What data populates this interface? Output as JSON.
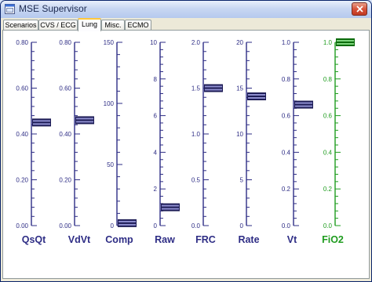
{
  "window": {
    "title": "MSE Supervisor"
  },
  "tabs": [
    {
      "label": "Scenarios",
      "active": false
    },
    {
      "label": "CVS / ECG",
      "active": false
    },
    {
      "label": "Lung",
      "active": true
    },
    {
      "label": "Misc.",
      "active": false
    },
    {
      "label": "ECMO",
      "active": false
    }
  ],
  "colors": {
    "gauge": "#2e2d85",
    "gauge_active": "#1f9c1f",
    "thumb_dark": "#1c1b55",
    "thumb_light": "#8f8fd0",
    "thumb_green_dark": "#0b6b0b",
    "thumb_green_light": "#7cd47c"
  },
  "icons": {
    "window": "app-window-icon",
    "close": "close-icon"
  },
  "gauges": [
    {
      "id": "qsqt",
      "label": "QsQt",
      "ticks": [
        "0.80",
        "0.60",
        "0.40",
        "0.20",
        "0.00"
      ],
      "min": 0,
      "max": 0.8,
      "value": 0.45,
      "color": "default"
    },
    {
      "id": "vdvt",
      "label": "VdVt",
      "ticks": [
        "0.80",
        "0.60",
        "0.40",
        "0.20",
        "0.00"
      ],
      "min": 0,
      "max": 0.8,
      "value": 0.46,
      "color": "default"
    },
    {
      "id": "comp",
      "label": "Comp",
      "ticks": [
        "150",
        "100",
        "50",
        "0"
      ],
      "min": 0,
      "max": 150,
      "value": 2,
      "color": "default"
    },
    {
      "id": "raw",
      "label": "Raw",
      "ticks": [
        "10",
        "8",
        "6",
        "4",
        "2",
        "0"
      ],
      "min": 0,
      "max": 10,
      "value": 1,
      "color": "default"
    },
    {
      "id": "frc",
      "label": "FRC",
      "ticks": [
        "2.0",
        "1.5",
        "1.0",
        "0.5",
        "0.0"
      ],
      "min": 0,
      "max": 2,
      "value": 1.5,
      "color": "default"
    },
    {
      "id": "rate",
      "label": "Rate",
      "ticks": [
        "20",
        "15",
        "10",
        "5",
        "0"
      ],
      "min": 0,
      "max": 20,
      "value": 14.1,
      "color": "default"
    },
    {
      "id": "vt",
      "label": "Vt",
      "ticks": [
        "1.0",
        "0.8",
        "0.6",
        "0.4",
        "0.2",
        "0.0"
      ],
      "min": 0,
      "max": 1,
      "value": 0.66,
      "color": "default"
    },
    {
      "id": "fio2",
      "label": "FiO2",
      "ticks": [
        "1.0",
        "0.8",
        "0.6",
        "0.4",
        "0.2",
        "0.0"
      ],
      "min": 0,
      "max": 1,
      "value": 1.0,
      "color": "active"
    }
  ]
}
